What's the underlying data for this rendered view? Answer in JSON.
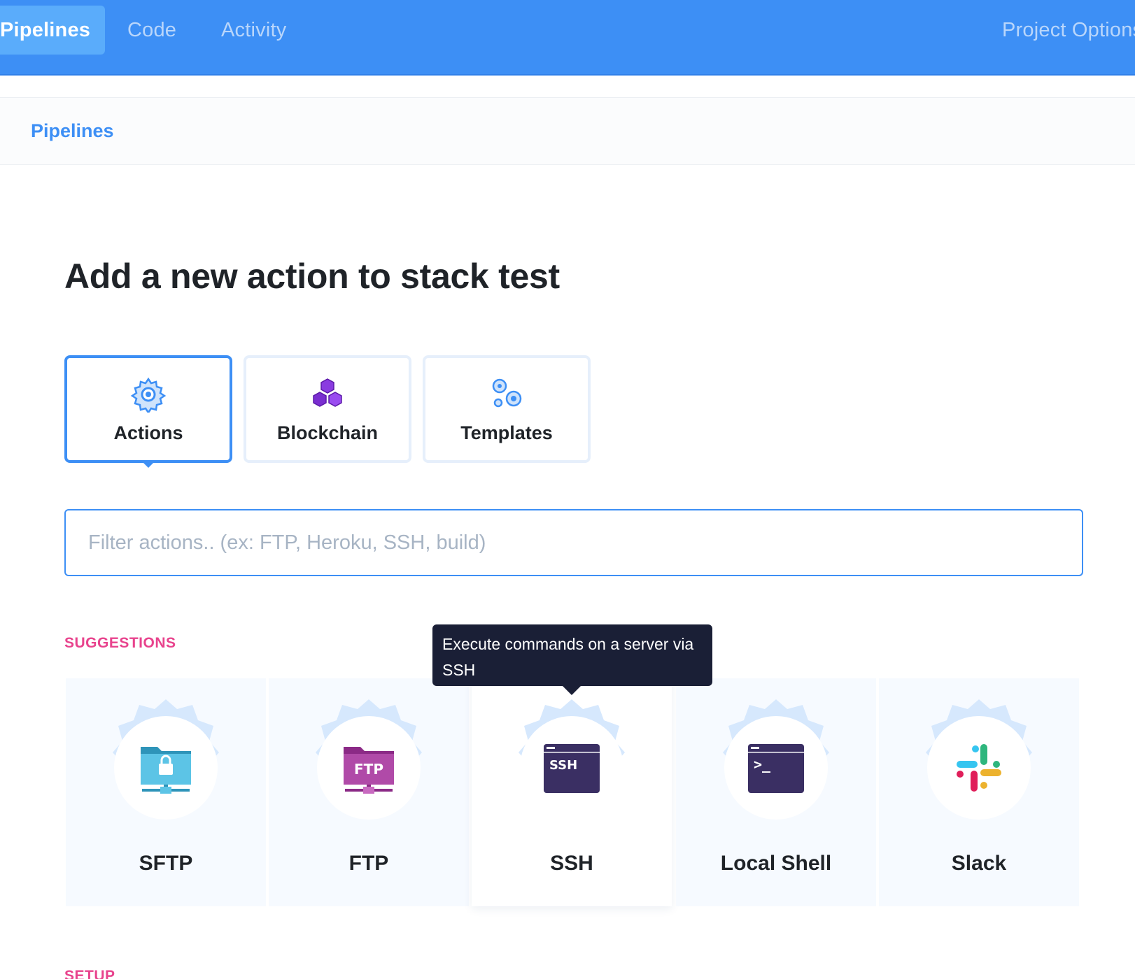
{
  "nav": {
    "tabs": [
      {
        "label": "Pipelines",
        "active": true
      },
      {
        "label": "Code"
      },
      {
        "label": "Activity"
      }
    ],
    "options_label": "Project Options"
  },
  "breadcrumb": {
    "label": "Pipelines"
  },
  "page": {
    "title": "Add a new action to stack test"
  },
  "categories": [
    {
      "label": "Actions",
      "icon": "gear-icon",
      "active": true
    },
    {
      "label": "Blockchain",
      "icon": "hexagon-cluster-icon"
    },
    {
      "label": "Templates",
      "icon": "gears-icon"
    }
  ],
  "filter": {
    "placeholder": "Filter actions.. (ex: FTP, Heroku, SSH, build)"
  },
  "sections": {
    "suggestions": "SUGGESTIONS",
    "setup": "SETUP"
  },
  "tooltip": {
    "text": "Execute commands on a server via SSH"
  },
  "actions": [
    {
      "label": "SFTP",
      "icon": "sftp-folder-icon"
    },
    {
      "label": "FTP",
      "icon": "ftp-folder-icon",
      "badge": "FTP"
    },
    {
      "label": "SSH",
      "icon": "ssh-terminal-icon",
      "badge": "SSH"
    },
    {
      "label": "Local Shell",
      "icon": "shell-terminal-icon",
      "badge": ">_"
    },
    {
      "label": "Slack",
      "icon": "slack-icon"
    }
  ],
  "colors": {
    "nav": "#3d8ff5",
    "accent": "#3d8ff5",
    "section": "#e8438d",
    "tooltip": "#1a1f36",
    "card_bg": "#f6faff"
  }
}
